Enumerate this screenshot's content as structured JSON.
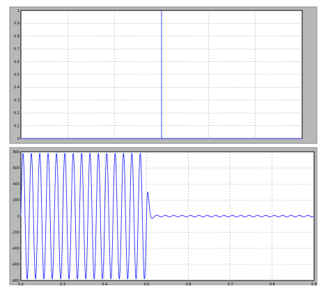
{
  "window": {
    "background": "#b8b8b8"
  },
  "colors": {
    "trace": "#2a2aff",
    "grid": "#8c8c8c",
    "axes_bg": "#ffffff"
  },
  "chart_data": [
    {
      "type": "line",
      "title": "",
      "xlabel": "",
      "ylabel": "",
      "xlim": [
        0.2,
        0.5
      ],
      "ylim": [
        0,
        1
      ],
      "grid": true,
      "x_ticks": [
        0.2,
        0.25,
        0.3,
        0.35,
        0.4,
        0.45,
        0.5
      ],
      "x_tick_labels": [],
      "y_ticks": [
        0,
        0.1,
        0.2,
        0.3,
        0.4,
        0.5,
        0.6,
        0.7,
        0.8,
        0.9,
        1
      ],
      "y_tick_labels": [
        "0",
        "0.1",
        "0.2",
        "0.3",
        "0.4",
        "0.5",
        "0.6",
        "0.7",
        "0.8",
        "0.9",
        "1"
      ],
      "series": [
        {
          "color": "#2a2aff",
          "x": [
            0.2,
            0.35,
            0.35,
            0.35,
            0.35,
            0.5
          ],
          "y": [
            0,
            0,
            1,
            1,
            0,
            0
          ]
        }
      ]
    },
    {
      "type": "line",
      "title": "",
      "xlabel": "",
      "ylabel": "",
      "xlim": [
        0.2,
        0.9
      ],
      "ylim": [
        -800,
        800
      ],
      "grid": true,
      "x_ticks": [
        0.2,
        0.3,
        0.4,
        0.5,
        0.6,
        0.7,
        0.8,
        0.9
      ],
      "x_tick_labels": [
        "0.2",
        "0.3",
        "0.4",
        "0.5",
        "0.6",
        "0.7",
        "0.8",
        "0.9"
      ],
      "y_ticks": [
        -800,
        -600,
        -400,
        -200,
        0,
        200,
        400,
        600,
        800
      ],
      "y_tick_labels": [
        "-800",
        "-600",
        "-400",
        "-200",
        "0",
        "200",
        "400",
        "600",
        "800"
      ],
      "series": [
        {
          "color": "#2a2aff",
          "type": "sinusoid",
          "x_start": 0.2,
          "x_cutoff": 0.5,
          "x_end": 0.9,
          "frequency": 50,
          "amplitude": 780,
          "residual_amplitude": 10
        }
      ]
    }
  ]
}
